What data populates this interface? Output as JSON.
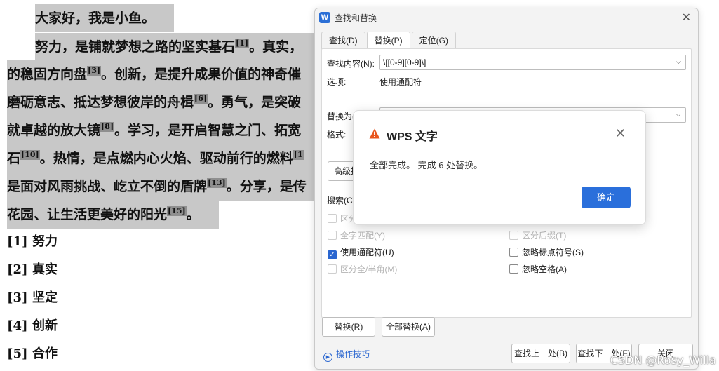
{
  "document": {
    "paragraph1": "大家好，我是小鱼。",
    "line2": {
      "text": "努力，是铺就梦想之路的坚实基石",
      "ref": "[1]",
      "tail": "。真实，"
    },
    "line3": {
      "text": "的稳固方向盘",
      "ref": "[3]",
      "tail": "。创新，是提升成果价值的神奇催"
    },
    "line4": {
      "text": "磨砺意志、抵达梦想彼岸的舟楫",
      "ref": "[6]",
      "tail": "。勇气，是突破"
    },
    "line5": {
      "text": "就卓越的放大镜",
      "ref": "[8]",
      "tail": "。学习，是开启智慧之门、拓宽"
    },
    "line6": {
      "text": "石",
      "ref": "[10]",
      "tail": "。热情，是点燃内心火焰、驱动前行的燃料",
      "ref2": "[1"
    },
    "line7": {
      "text": "是面对风雨挑战、屹立不倒的盾牌",
      "ref": "[13]",
      "tail": "。分享，是传"
    },
    "line8": {
      "text": "花园、让生活更美好的阳光",
      "ref": "[15]",
      "tail": "。"
    },
    "references": [
      {
        "num": "[1]",
        "text": "努力"
      },
      {
        "num": "[2]",
        "text": "真实"
      },
      {
        "num": "[3]",
        "text": "坚定"
      },
      {
        "num": "[4]",
        "text": "创新"
      },
      {
        "num": "[5]",
        "text": "合作"
      }
    ]
  },
  "dialog": {
    "icon": "W",
    "title": "查找和替换",
    "close": "✕",
    "tabs": [
      "查找(D)",
      "替换(P)",
      "定位(G)"
    ],
    "find_label": "查找内容(N):",
    "find_value": "\\[[0-9][0-9]\\]",
    "options_label": "选项:",
    "options_value": "使用通配符",
    "replace_label": "替换为(",
    "format_label": "格式:",
    "advanced_button": "高级搜",
    "search_label": "搜索(C)",
    "checkboxes": {
      "match_case": "区分",
      "whole_word": "全字匹配(Y)",
      "use_wildcards": "使用通配符(U)",
      "full_half": "区分全/半角(M)",
      "match_suffix": "区分后缀(T)",
      "ignore_punct": "忽略标点符号(S)",
      "ignore_space": "忽略空格(A)"
    },
    "buttons": {
      "replace": "替换(R)",
      "replace_all": "全部替换(A)",
      "find_prev": "查找上一处(B)",
      "find_next": "查找下一处(F)",
      "close": "关闭"
    },
    "tips": "操作技巧"
  },
  "message": {
    "title": "WPS 文字",
    "text": "全部完成。 完成 6 处替换。",
    "ok": "确定",
    "close": "✕"
  },
  "watermark": "CSDN @Rosy_Willa",
  "colors": {
    "accent": "#2a6fdb",
    "warning": "#e8541c",
    "highlight": "#c8c8c8"
  }
}
